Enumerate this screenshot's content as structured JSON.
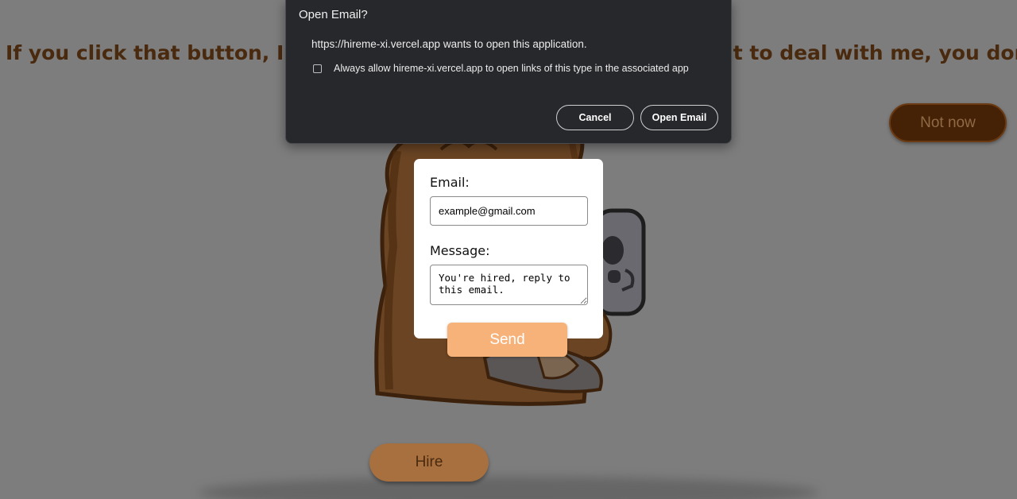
{
  "page": {
    "headline": "If you click that button, I'm going to fire you since you don't want to deal with me, you don't want to deal with",
    "not_now_label": "Not now",
    "hire_label": "Hire"
  },
  "contact_form": {
    "email_label": "Email:",
    "email_value": "example@gmail.com",
    "message_label": "Message:",
    "message_value": "You're hired, reply to this email.",
    "send_label": "Send"
  },
  "dialog": {
    "title": "Open Email?",
    "message": "https://hireme-xi.vercel.app wants to open this application.",
    "checkbox_label": "Always allow hireme-xi.vercel.app to open links of this type in the associated app",
    "checkbox_checked": false,
    "cancel_label": "Cancel",
    "open_label": "Open Email"
  },
  "colors": {
    "overlay": "#7d7d7d",
    "headline": "#4a2a0e",
    "dialog_bg": "#27282c",
    "send_button": "#f7b27a",
    "hire_button": "#a8703f",
    "not_now_button": "#452206"
  }
}
